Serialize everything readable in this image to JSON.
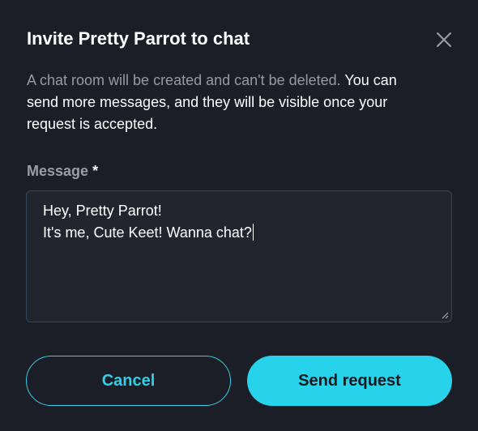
{
  "dialog": {
    "title": "Invite Pretty Parrot to chat",
    "close_icon": "close-icon",
    "description_muted": "A chat room will be created and can't be deleted.",
    "description_main": "You can send more messages, and they will be visible once your request is accepted."
  },
  "message_field": {
    "label": "Message",
    "required_marker": "*",
    "lines": [
      "Hey, Pretty Parrot!",
      "It's me, Cute Keet! Wanna chat?"
    ]
  },
  "buttons": {
    "cancel_label": "Cancel",
    "send_label": "Send request"
  },
  "colors": {
    "background": "#1b1e26",
    "accent": "#27d3ea",
    "muted_text": "#969aa6",
    "field_background": "#22252e",
    "field_border": "#31465a"
  }
}
